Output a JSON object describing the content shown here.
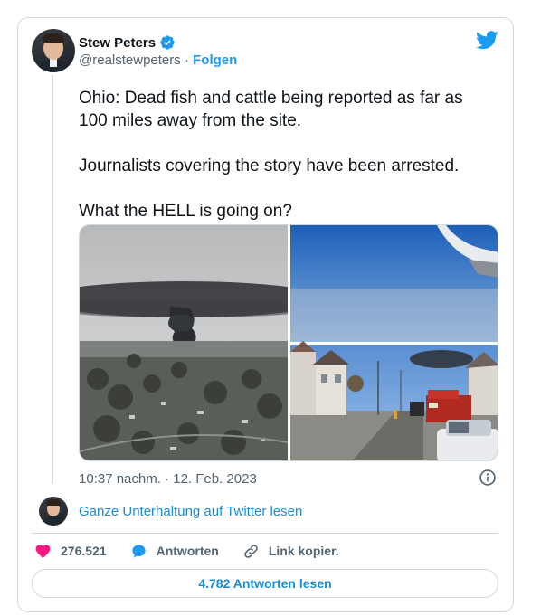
{
  "author": {
    "display_name": "Stew Peters",
    "handle": "@realstewpeters",
    "separator": " · ",
    "follow_label": "Folgen",
    "verified": true
  },
  "tweet": {
    "paragraphs": [
      "Ohio: Dead fish and cattle being reported as far as 100 miles away from the site.",
      "Journalists covering the story have been arrested.",
      "What the HELL is going on?"
    ],
    "timestamp": "10:37 nachm. · 12. Feb. 2023"
  },
  "media": {
    "images": [
      {
        "name": "smoke-plume-over-town-photo"
      },
      {
        "name": "airplane-window-view-photo"
      },
      {
        "name": "street-with-emergency-vehicles-photo"
      }
    ]
  },
  "conversation": {
    "read_label": "Ganze Unterhaltung auf Twitter lesen"
  },
  "actions": {
    "likes": "276.521",
    "reply_label": "Antworten",
    "copy_link_label": "Link kopier."
  },
  "footer": {
    "read_replies_label": "4.782 Antworten lesen"
  },
  "colors": {
    "accent": "#1d9bf0",
    "like": "#f91880",
    "muted": "#536471",
    "border": "#cfd9de"
  },
  "icons": [
    "verified-badge-icon",
    "twitter-bird-icon",
    "info-icon",
    "heart-icon",
    "reply-bubble-icon",
    "link-icon"
  ]
}
